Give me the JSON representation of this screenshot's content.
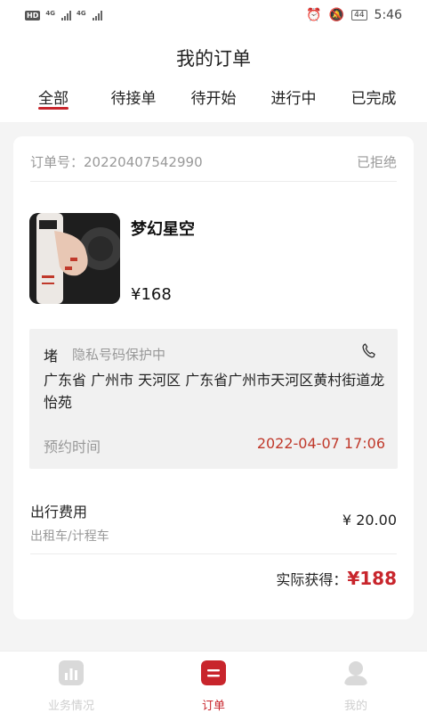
{
  "status_bar": {
    "hd": "HD",
    "net1": "4G",
    "net2": "4G",
    "battery": "44",
    "time": "5:46"
  },
  "header": {
    "title": "我的订单",
    "tabs": [
      {
        "label": "全部",
        "active": true
      },
      {
        "label": "待接单",
        "active": false
      },
      {
        "label": "待开始",
        "active": false
      },
      {
        "label": "进行中",
        "active": false
      },
      {
        "label": "已完成",
        "active": false
      }
    ]
  },
  "order": {
    "number_label": "订单号：20220407542990",
    "status": "已拒绝",
    "product_name": "梦幻星空",
    "price": "¥168",
    "contact_name": "堵",
    "privacy_note": "隐私号码保护中",
    "address": "广东省 广州市 天河区 广东省广州市天河区黄村街道龙怡苑",
    "appointment_label": "预约时间",
    "appointment_time": "2022-04-07 17:06",
    "fee_label": "出行费用",
    "fee_type": "出租车/计程车",
    "fee_amount": "¥ 20.00",
    "earn_label": "实际获得：",
    "earn_value": "¥188"
  },
  "bottom_nav": [
    {
      "label": "业务情况",
      "icon": "chart-icon",
      "active": false
    },
    {
      "label": "订单",
      "icon": "order-icon",
      "active": true
    },
    {
      "label": "我的",
      "icon": "user-icon",
      "active": false
    }
  ],
  "colors": {
    "accent": "#c8252c",
    "time_red": "#c0392b",
    "muted": "#999999"
  }
}
